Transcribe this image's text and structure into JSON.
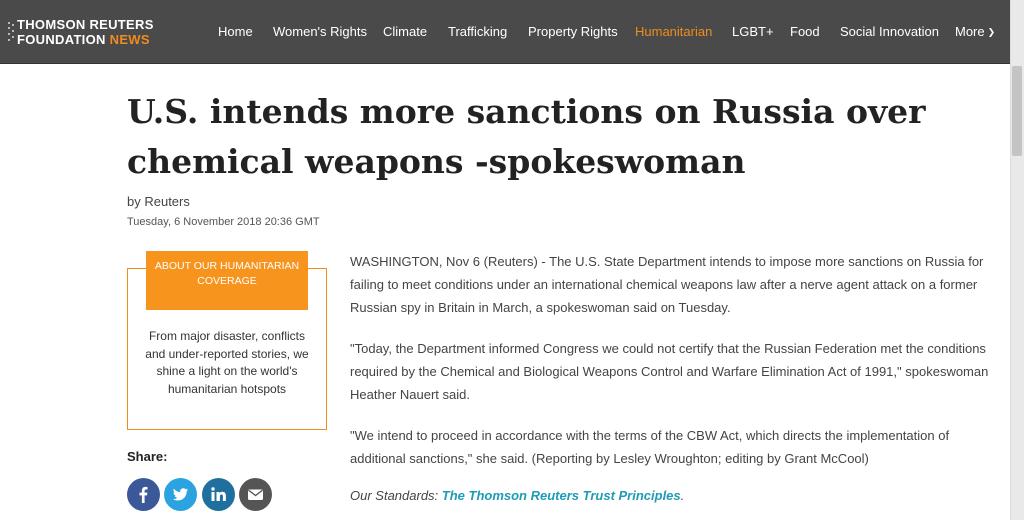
{
  "brand": {
    "line1": "THOMSON REUTERS",
    "line2": "FOUNDATION",
    "line2_accent": "NEWS",
    "accent_color": "#f08c1e"
  },
  "nav": {
    "items": [
      {
        "label": "Home",
        "active": false
      },
      {
        "label": "Women's Rights",
        "active": false
      },
      {
        "label": "Climate",
        "active": false
      },
      {
        "label": "Trafficking",
        "active": false
      },
      {
        "label": "Property Rights",
        "active": false
      },
      {
        "label": "Humanitarian",
        "active": true
      },
      {
        "label": "LGBT+",
        "active": false
      },
      {
        "label": "Food",
        "active": false
      },
      {
        "label": "Social Innovation",
        "active": false
      },
      {
        "label": "More",
        "active": false,
        "icon": "chevron-down-icon"
      }
    ]
  },
  "article": {
    "headline_line1": "U.S. intends more sanctions on Russia over",
    "headline_line2": "chemical weapons -spokeswoman",
    "byline": "by Reuters",
    "date": "Tuesday, 6 November 2018 20:36 GMT",
    "paragraphs": [
      "WASHINGTON, Nov 6 (Reuters) - The U.S. State Department intends to impose more sanctions on Russia for failing to meet conditions under an international chemical weapons law after a nerve agent attack on a former Russian spy in Britain in March, a spokeswoman said on Tuesday.",
      "\"Today, the Department informed Congress we could not certify that the Russian Federation met the conditions required by the Chemical and Biological Weapons Control and Warfare Elimination Act of 1991,\" spokeswoman Heather Nauert said.",
      "\"We intend to proceed in accordance with the terms of the CBW Act, which directs the implementation of additional sanctions,\" she said. (Reporting by Lesley Wroughton; editing by Grant McCool)"
    ],
    "standards_prefix": "Our Standards:",
    "standards_link": "The Thomson Reuters Trust Principles",
    "standards_suffix": "."
  },
  "promo": {
    "heading": "ABOUT OUR HUMANITARIAN COVERAGE",
    "text": "From major disaster, conflicts and under-reported stories, we shine a light on the world's humanitarian hotspots"
  },
  "share": {
    "label": "Share:",
    "buttons": [
      {
        "name": "facebook",
        "icon": "facebook-icon",
        "color": "#3b5998"
      },
      {
        "name": "twitter",
        "icon": "twitter-icon",
        "color": "#2aa3e0"
      },
      {
        "name": "linkedin",
        "icon": "linkedin-icon",
        "color": "#1f6f9f"
      },
      {
        "name": "email",
        "icon": "email-icon",
        "color": "#555555"
      }
    ]
  }
}
